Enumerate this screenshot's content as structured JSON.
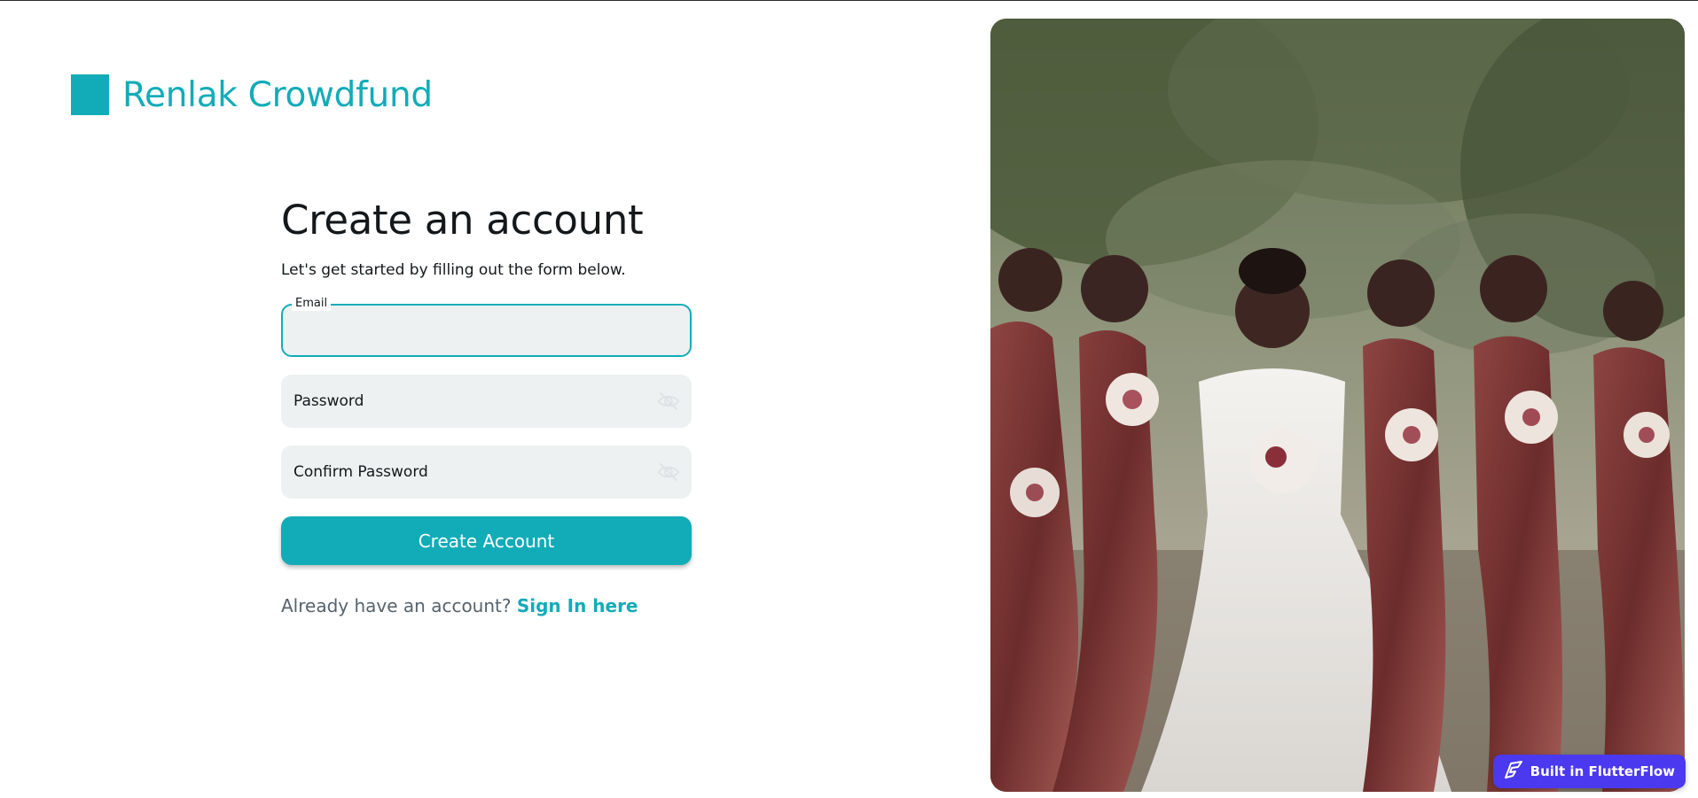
{
  "colors": {
    "accent": "#12acb8",
    "badge": "#4b39ef"
  },
  "brand": {
    "name": "Renlak Crowdfund",
    "logo_icon": "square-logo-icon"
  },
  "form": {
    "title": "Create an account",
    "subtitle": "Let's get started by filling out the form below.",
    "email": {
      "label": "Email",
      "value": "",
      "focused": true
    },
    "password": {
      "placeholder": "Password",
      "value": "",
      "toggle_icon": "eye-off-icon"
    },
    "confirm_password": {
      "placeholder": "Confirm Password",
      "value": "",
      "toggle_icon": "eye-off-icon"
    },
    "submit_label": "Create Account",
    "signin_prompt": "Already have an account?",
    "signin_link": "Sign In here"
  },
  "badge": {
    "label": "Built in FlutterFlow",
    "icon": "flutterflow-icon"
  }
}
